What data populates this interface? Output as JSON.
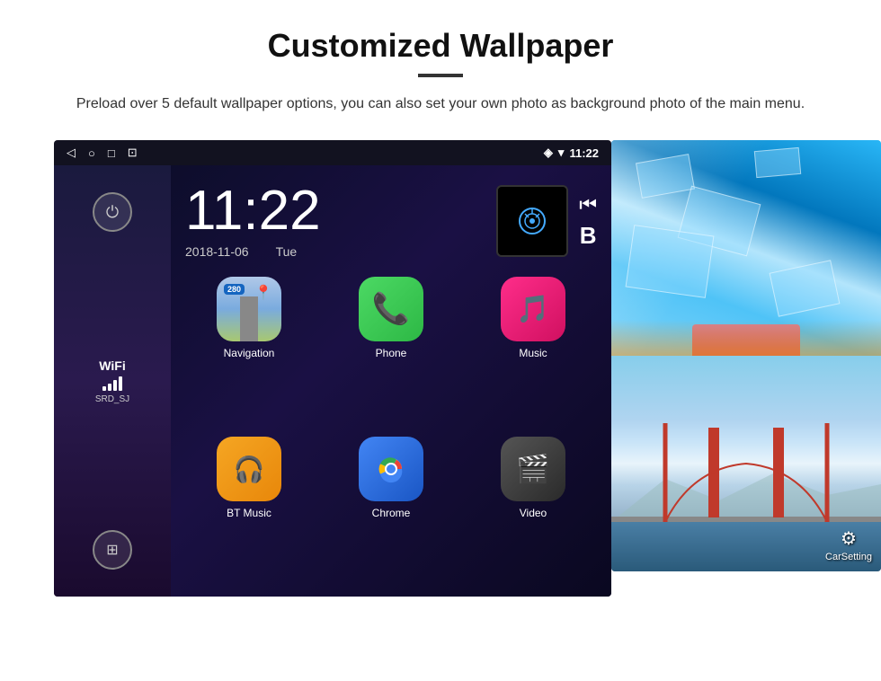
{
  "header": {
    "title": "Customized Wallpaper",
    "subtitle": "Preload over 5 default wallpaper options, you can also set your own photo as background photo of the main menu."
  },
  "android": {
    "statusBar": {
      "time": "11:22",
      "icons": [
        "back",
        "home",
        "square",
        "image"
      ]
    },
    "clock": {
      "time": "11:22",
      "date": "2018-11-06",
      "day": "Tue"
    },
    "sidebar": {
      "wifiLabel": "WiFi",
      "wifiSSID": "SRD_SJ"
    },
    "apps": [
      {
        "name": "Navigation",
        "label": "Navigation",
        "type": "navigation"
      },
      {
        "name": "Phone",
        "label": "Phone",
        "type": "phone"
      },
      {
        "name": "Music",
        "label": "Music",
        "type": "music"
      },
      {
        "name": "BT Music",
        "label": "BT Music",
        "type": "btmusic"
      },
      {
        "name": "Chrome",
        "label": "Chrome",
        "type": "chrome"
      },
      {
        "name": "Video",
        "label": "Video",
        "type": "video"
      }
    ],
    "carsetting": {
      "label": "CarSetting"
    },
    "navBadge": "280"
  }
}
